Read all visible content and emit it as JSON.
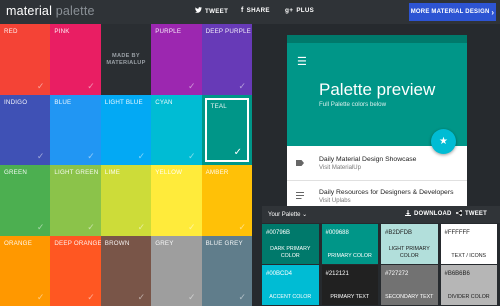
{
  "header": {
    "logo_main": "material",
    "logo_light": " palette",
    "tweet_label": "TWEET",
    "share_label": "SHARE",
    "plus_label": "PLUS",
    "cta_label": "MORE MATERIAL DESIGN",
    "cta_arrow": "›"
  },
  "palette": {
    "check": "✓",
    "made_by_line1": "MADE BY",
    "made_by_line2": "MATERIALUP",
    "selected": "TEAL",
    "colors": [
      {
        "name": "RED",
        "hex": "#f44336"
      },
      {
        "name": "PINK",
        "hex": "#e91e63"
      },
      {
        "name": "PURPLE",
        "hex": "#9c27b0"
      },
      {
        "name": "DEEP PURPLE",
        "hex": "#673ab7"
      },
      {
        "name": "INDIGO",
        "hex": "#3f51b5"
      },
      {
        "name": "BLUE",
        "hex": "#2196f3"
      },
      {
        "name": "LIGHT BLUE",
        "hex": "#03a9f4"
      },
      {
        "name": "CYAN",
        "hex": "#00bcd4"
      },
      {
        "name": "TEAL",
        "hex": "#009688"
      },
      {
        "name": "GREEN",
        "hex": "#4caf50"
      },
      {
        "name": "LIGHT GREEN",
        "hex": "#8bc34a"
      },
      {
        "name": "LIME",
        "hex": "#cddc39"
      },
      {
        "name": "YELLOW",
        "hex": "#ffeb3b"
      },
      {
        "name": "AMBER",
        "hex": "#ffc107"
      },
      {
        "name": "ORANGE",
        "hex": "#ff9800"
      },
      {
        "name": "DEEP ORANGE",
        "hex": "#ff5722"
      },
      {
        "name": "BROWN",
        "hex": "#795548"
      },
      {
        "name": "GREY",
        "hex": "#9e9e9e"
      },
      {
        "name": "BLUE GREY",
        "hex": "#607d8b"
      }
    ]
  },
  "preview": {
    "title": "Palette preview",
    "subtitle": "Full Palette colors below",
    "items": [
      {
        "title": "Daily Material Design Showcase",
        "subtitle": "Visit MaterialUp",
        "icon": "label-icon"
      },
      {
        "title": "Daily Resources for Designers & Developers",
        "subtitle": "Visit Uplabs",
        "icon": "article-icon"
      }
    ]
  },
  "your_palette": {
    "label": "Your Palette",
    "caret": "⌄",
    "download_label": "DOWNLOAD",
    "tweet_label": "TWEET",
    "swatches": [
      {
        "hex": "#00796B",
        "caption_1": "DARK PRIMARY",
        "caption_2": "COLOR"
      },
      {
        "hex": "#009688",
        "caption_1": "PRIMARY COLOR",
        "caption_2": ""
      },
      {
        "hex": "#B2DFDB",
        "caption_1": "LIGHT PRIMARY",
        "caption_2": "COLOR"
      },
      {
        "hex": "#FFFFFF",
        "caption_1": "TEXT / ICONS",
        "caption_2": ""
      },
      {
        "hex": "#00BCD4",
        "caption_1": "ACCENT COLOR",
        "caption_2": ""
      },
      {
        "hex": "#212121",
        "caption_1": "PRIMARY TEXT",
        "caption_2": ""
      },
      {
        "hex": "#727272",
        "caption_1": "SECONDARY TEXT",
        "caption_2": ""
      },
      {
        "hex": "#B6B6B6",
        "caption_1": "DIVIDER COLOR",
        "caption_2": ""
      }
    ]
  }
}
